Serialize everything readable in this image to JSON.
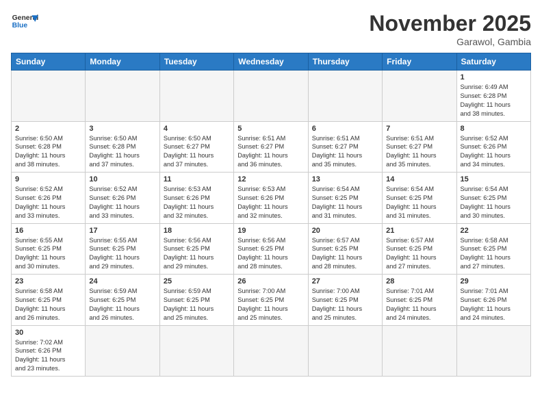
{
  "header": {
    "logo_line1": "General",
    "logo_line2": "Blue",
    "month_title": "November 2025",
    "location": "Garawol, Gambia"
  },
  "weekdays": [
    "Sunday",
    "Monday",
    "Tuesday",
    "Wednesday",
    "Thursday",
    "Friday",
    "Saturday"
  ],
  "weeks": [
    [
      {
        "day": "",
        "info": ""
      },
      {
        "day": "",
        "info": ""
      },
      {
        "day": "",
        "info": ""
      },
      {
        "day": "",
        "info": ""
      },
      {
        "day": "",
        "info": ""
      },
      {
        "day": "",
        "info": ""
      },
      {
        "day": "1",
        "info": "Sunrise: 6:49 AM\nSunset: 6:28 PM\nDaylight: 11 hours\nand 38 minutes."
      }
    ],
    [
      {
        "day": "2",
        "info": "Sunrise: 6:50 AM\nSunset: 6:28 PM\nDaylight: 11 hours\nand 38 minutes."
      },
      {
        "day": "3",
        "info": "Sunrise: 6:50 AM\nSunset: 6:28 PM\nDaylight: 11 hours\nand 37 minutes."
      },
      {
        "day": "4",
        "info": "Sunrise: 6:50 AM\nSunset: 6:27 PM\nDaylight: 11 hours\nand 37 minutes."
      },
      {
        "day": "5",
        "info": "Sunrise: 6:51 AM\nSunset: 6:27 PM\nDaylight: 11 hours\nand 36 minutes."
      },
      {
        "day": "6",
        "info": "Sunrise: 6:51 AM\nSunset: 6:27 PM\nDaylight: 11 hours\nand 35 minutes."
      },
      {
        "day": "7",
        "info": "Sunrise: 6:51 AM\nSunset: 6:27 PM\nDaylight: 11 hours\nand 35 minutes."
      },
      {
        "day": "8",
        "info": "Sunrise: 6:52 AM\nSunset: 6:26 PM\nDaylight: 11 hours\nand 34 minutes."
      }
    ],
    [
      {
        "day": "9",
        "info": "Sunrise: 6:52 AM\nSunset: 6:26 PM\nDaylight: 11 hours\nand 33 minutes."
      },
      {
        "day": "10",
        "info": "Sunrise: 6:52 AM\nSunset: 6:26 PM\nDaylight: 11 hours\nand 33 minutes."
      },
      {
        "day": "11",
        "info": "Sunrise: 6:53 AM\nSunset: 6:26 PM\nDaylight: 11 hours\nand 32 minutes."
      },
      {
        "day": "12",
        "info": "Sunrise: 6:53 AM\nSunset: 6:26 PM\nDaylight: 11 hours\nand 32 minutes."
      },
      {
        "day": "13",
        "info": "Sunrise: 6:54 AM\nSunset: 6:25 PM\nDaylight: 11 hours\nand 31 minutes."
      },
      {
        "day": "14",
        "info": "Sunrise: 6:54 AM\nSunset: 6:25 PM\nDaylight: 11 hours\nand 31 minutes."
      },
      {
        "day": "15",
        "info": "Sunrise: 6:54 AM\nSunset: 6:25 PM\nDaylight: 11 hours\nand 30 minutes."
      }
    ],
    [
      {
        "day": "16",
        "info": "Sunrise: 6:55 AM\nSunset: 6:25 PM\nDaylight: 11 hours\nand 30 minutes."
      },
      {
        "day": "17",
        "info": "Sunrise: 6:55 AM\nSunset: 6:25 PM\nDaylight: 11 hours\nand 29 minutes."
      },
      {
        "day": "18",
        "info": "Sunrise: 6:56 AM\nSunset: 6:25 PM\nDaylight: 11 hours\nand 29 minutes."
      },
      {
        "day": "19",
        "info": "Sunrise: 6:56 AM\nSunset: 6:25 PM\nDaylight: 11 hours\nand 28 minutes."
      },
      {
        "day": "20",
        "info": "Sunrise: 6:57 AM\nSunset: 6:25 PM\nDaylight: 11 hours\nand 28 minutes."
      },
      {
        "day": "21",
        "info": "Sunrise: 6:57 AM\nSunset: 6:25 PM\nDaylight: 11 hours\nand 27 minutes."
      },
      {
        "day": "22",
        "info": "Sunrise: 6:58 AM\nSunset: 6:25 PM\nDaylight: 11 hours\nand 27 minutes."
      }
    ],
    [
      {
        "day": "23",
        "info": "Sunrise: 6:58 AM\nSunset: 6:25 PM\nDaylight: 11 hours\nand 26 minutes."
      },
      {
        "day": "24",
        "info": "Sunrise: 6:59 AM\nSunset: 6:25 PM\nDaylight: 11 hours\nand 26 minutes."
      },
      {
        "day": "25",
        "info": "Sunrise: 6:59 AM\nSunset: 6:25 PM\nDaylight: 11 hours\nand 25 minutes."
      },
      {
        "day": "26",
        "info": "Sunrise: 7:00 AM\nSunset: 6:25 PM\nDaylight: 11 hours\nand 25 minutes."
      },
      {
        "day": "27",
        "info": "Sunrise: 7:00 AM\nSunset: 6:25 PM\nDaylight: 11 hours\nand 25 minutes."
      },
      {
        "day": "28",
        "info": "Sunrise: 7:01 AM\nSunset: 6:25 PM\nDaylight: 11 hours\nand 24 minutes."
      },
      {
        "day": "29",
        "info": "Sunrise: 7:01 AM\nSunset: 6:26 PM\nDaylight: 11 hours\nand 24 minutes."
      }
    ],
    [
      {
        "day": "30",
        "info": "Sunrise: 7:02 AM\nSunset: 6:26 PM\nDaylight: 11 hours\nand 23 minutes."
      },
      {
        "day": "",
        "info": ""
      },
      {
        "day": "",
        "info": ""
      },
      {
        "day": "",
        "info": ""
      },
      {
        "day": "",
        "info": ""
      },
      {
        "day": "",
        "info": ""
      },
      {
        "day": "",
        "info": ""
      }
    ]
  ]
}
